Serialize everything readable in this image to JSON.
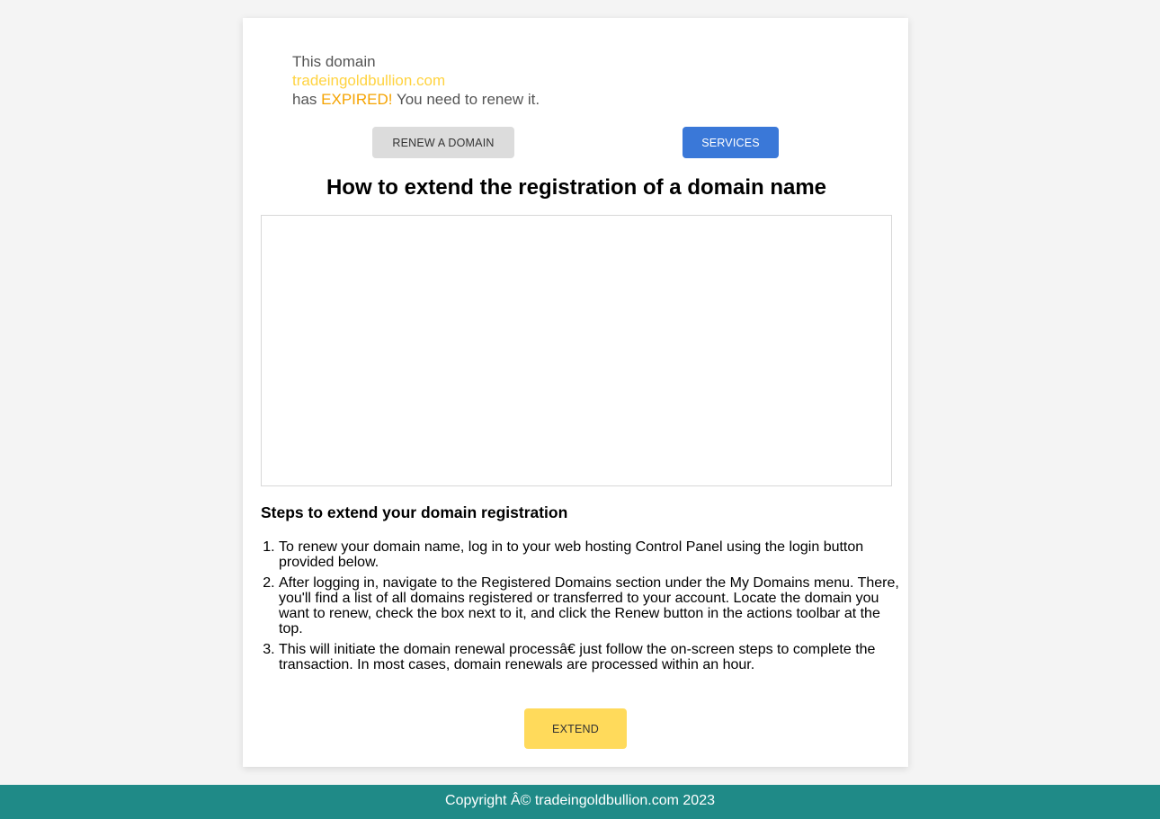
{
  "notice": {
    "line1": "This domain",
    "domain": "tradeingoldbullion.com",
    "has": "has",
    "expired": "EXPIRED!",
    "tail": "You need to renew it."
  },
  "buttons": {
    "renew": "RENEW A DOMAIN",
    "services": "SERVICES",
    "extend": "EXTEND"
  },
  "heading": "How to extend the registration of a domain name",
  "steps_title": "Steps to extend your domain registration",
  "steps": [
    "To renew your domain name, log in to your web hosting Control Panel using the login button provided below.",
    "After logging in, navigate to the Registered Domains section under the My Domains menu. There, you'll find a list of all domains registered or transferred to your account. Locate the domain you want to renew, check the box next to it, and click the Renew button in the actions toolbar at the top.",
    "This will initiate the domain renewal processâ€ just follow the on-screen steps to complete the transaction. In most cases, domain renewals are processed within an hour."
  ],
  "footer": "Copyright Â© tradeingoldbullion.com 2023",
  "colors": {
    "domain": "#ffd340",
    "expired": "#f5a300",
    "services": "#3a78d8",
    "extend": "#ffda5b",
    "footer": "#1f8a87"
  }
}
